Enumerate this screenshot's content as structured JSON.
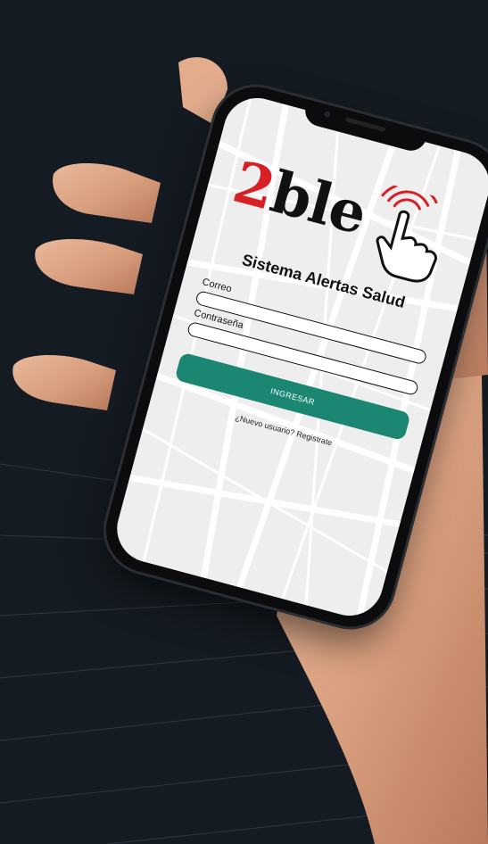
{
  "app": {
    "logo_number": "2",
    "logo_word": "ble",
    "title": "Sistema Alertas Salud"
  },
  "form": {
    "email_label": "Correo",
    "email_value": "",
    "password_label": "Contraseña",
    "password_value": "",
    "submit_label": "INGRESAR",
    "register_prompt": "¿Nuevo usuario? Registrate"
  },
  "colors": {
    "background": "#151b22",
    "logo_red": "#d81f26",
    "button_teal": "#1b8773",
    "screen_bg": "#efefef"
  },
  "icons": {
    "logo_icon": "tapping-hand-icon"
  }
}
